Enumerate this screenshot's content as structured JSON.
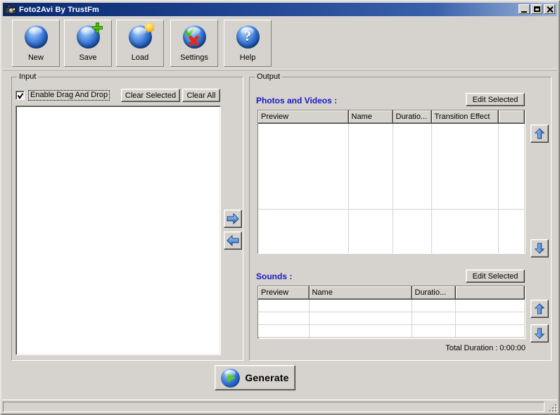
{
  "window": {
    "title": "Foto2Avi By TrustFm",
    "icon": "camera-icon",
    "controls": {
      "minimize": "_",
      "maximize": "□",
      "close": "✕"
    }
  },
  "toolbar": {
    "buttons": [
      {
        "label": "New",
        "icon": "blue-sphere-icon"
      },
      {
        "label": "Save",
        "icon": "blue-sphere-green-plus-icon"
      },
      {
        "label": "Load",
        "icon": "blue-sphere-orange-star-icon"
      },
      {
        "label": "Settings",
        "icon": "blue-sphere-check-x-icon"
      },
      {
        "label": "Help",
        "icon": "blue-sphere-question-icon"
      }
    ]
  },
  "input_panel": {
    "group_title": "Input",
    "enable_drag_and_drop": {
      "label": "Enable Drag And Drop",
      "checked": true
    },
    "clear_selected_label": "Clear Selected",
    "clear_all_label": "Clear All",
    "list_items": []
  },
  "transfer": {
    "move_right_icon": "arrow-right-icon",
    "move_left_icon": "arrow-left-icon"
  },
  "output_panel": {
    "group_title": "Output",
    "photos_and_videos": {
      "title": "Photos and Videos :",
      "edit_selected_label": "Edit Selected",
      "columns": [
        "Preview",
        "Name",
        "Duratio...",
        "Transition Effect",
        ""
      ],
      "rows": [],
      "move_up_icon": "arrow-up-icon",
      "move_down_icon": "arrow-down-icon"
    },
    "sounds": {
      "title": "Sounds :",
      "edit_selected_label": "Edit Selected",
      "columns": [
        "Preview",
        "Name",
        "Duratio...",
        ""
      ],
      "rows": [],
      "move_up_icon": "arrow-up-icon",
      "move_down_icon": "arrow-down-icon"
    },
    "total_duration": "Total Duration :  0:00:00"
  },
  "generate": {
    "label": "Generate",
    "icon": "play-circle-icon"
  },
  "statusbar": {
    "text": ""
  },
  "colors": {
    "title_bar_start": "#0a2a6e",
    "title_bar_end": "#9db7d9",
    "face": "#d6d3ce",
    "section_heading": "#1919c4",
    "field_bg": "#ffffff"
  }
}
